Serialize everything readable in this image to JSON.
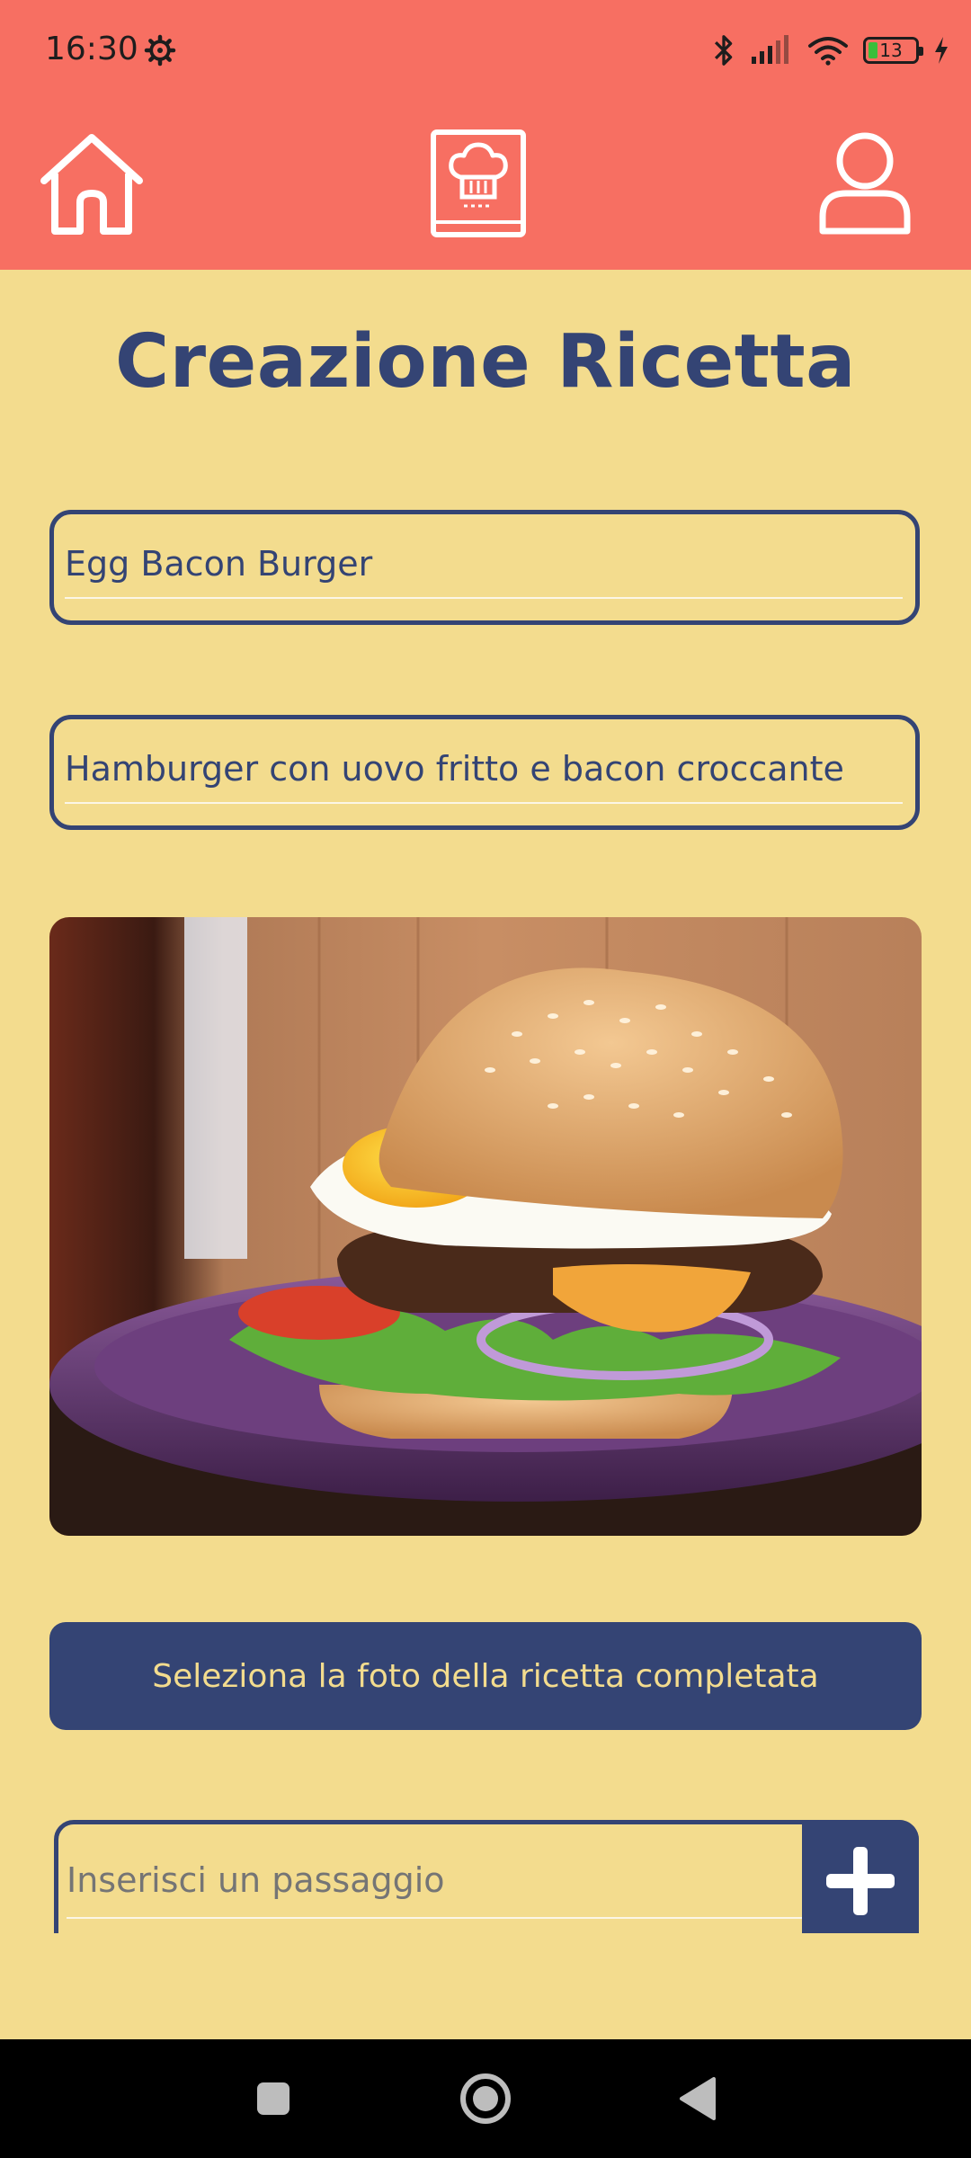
{
  "status": {
    "time": "16:30",
    "battery_level": "13",
    "icons": [
      "gear-icon",
      "bluetooth-icon",
      "signal-icon",
      "wifi-icon",
      "battery-icon",
      "charging-icon"
    ]
  },
  "appbar": {
    "icons": [
      "home-icon",
      "recipe-book-icon",
      "profile-icon"
    ]
  },
  "page": {
    "title": "Creazione Ricetta"
  },
  "form": {
    "recipe_name": "Egg Bacon Burger",
    "recipe_description": "Hamburger con uovo fritto e bacon croccante",
    "select_photo_label": "Seleziona la foto della ricetta completata",
    "step_placeholder": "Inserisci un passaggio"
  },
  "navigation": {
    "icons": [
      "recents-icon",
      "home-circle-icon",
      "back-icon"
    ]
  },
  "colors": {
    "accent": "#F76F62",
    "background": "#F3DC8E",
    "primary": "#344474"
  }
}
